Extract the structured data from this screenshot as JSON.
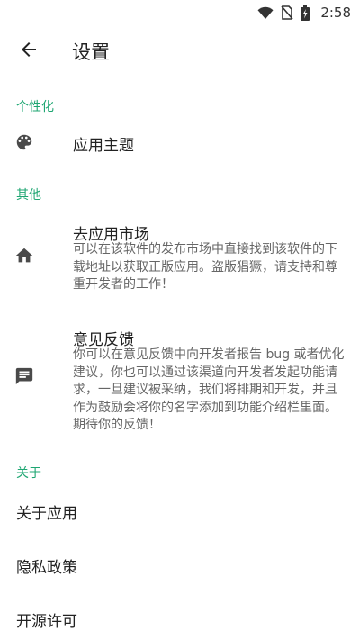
{
  "status_bar": {
    "time": "2:58",
    "icons": [
      "wifi-icon",
      "no-sim-icon",
      "battery-charging-icon"
    ]
  },
  "app_bar": {
    "title": "设置",
    "back_icon": "arrow-back-icon"
  },
  "sections": {
    "personalization": {
      "header": "个性化",
      "items": [
        {
          "icon": "palette-icon",
          "title": "应用主题"
        }
      ]
    },
    "other": {
      "header": "其他",
      "items": [
        {
          "icon": "home-icon",
          "title": "去应用市场",
          "description": "可以在该软件的发布市场中直接找到该软件的下载地址以获取正版应用。盗版猖獗，请支持和尊重开发者的工作！"
        },
        {
          "icon": "feedback-icon",
          "title": "意见反馈",
          "description": "你可以在意见反馈中向开发者报告 bug 或者优化建议，你也可以通过该渠道向开发者发起功能请求，一旦建议被采纳，我们将排期和开发，并且作为鼓励会将你的名字添加到功能介绍栏里面。期待你的反馈！"
        }
      ]
    },
    "about": {
      "header": "关于",
      "items": [
        {
          "title": "关于应用"
        },
        {
          "title": "隐私政策"
        },
        {
          "title": "开源许可"
        }
      ]
    }
  },
  "colors": {
    "accent": "#1ea672",
    "icon": "#4a4a4a",
    "description": "#666666"
  }
}
